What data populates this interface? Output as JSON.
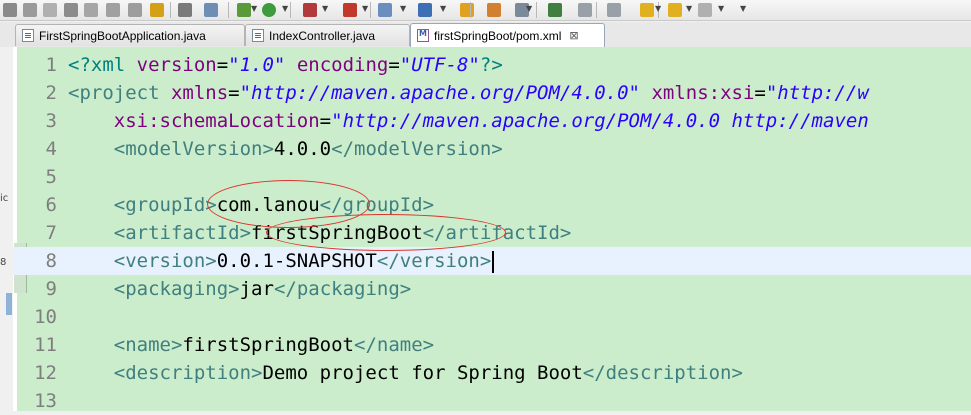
{
  "toolbar": {
    "icons": [
      "save-all-icon",
      "stop-icon",
      "disconnect-icon",
      "step-into-icon",
      "step-over-icon",
      "step-return-icon",
      "drop-to-frame-icon",
      "use-step-filters-icon",
      "open-task-icon",
      "build-icon",
      "debug-icon",
      "run-icon",
      "coverage-icon",
      "run-last-tool-icon",
      "new-wizard-icon",
      "new-class-icon",
      "open-type-icon",
      "search-icon",
      "globe-icon",
      "external-tools-icon",
      "next-annotation-icon",
      "prev-annotation-icon",
      "last-edit-icon",
      "back-icon",
      "forward-icon"
    ]
  },
  "tabs": [
    {
      "label": "FirstSpringBootApplication.java",
      "type": "java",
      "active": false
    },
    {
      "label": "IndexController.java",
      "type": "java",
      "active": false
    },
    {
      "label": "firstSpringBoot/pom.xml",
      "type": "xml",
      "active": true,
      "close": "⊠"
    }
  ],
  "left_fragments": [
    "ic",
    "8"
  ],
  "editor": {
    "current_line": 8,
    "lines": [
      {
        "n": "1",
        "parts": [
          [
            "pi",
            "<?xml "
          ],
          [
            "a",
            "version"
          ],
          [
            "",
            "="
          ],
          [
            "v",
            "\"1.0\""
          ],
          [
            "pi",
            " "
          ],
          [
            "a",
            "encoding"
          ],
          [
            "",
            "="
          ],
          [
            "v",
            "\"UTF-8\""
          ],
          [
            "pi",
            "?>"
          ]
        ]
      },
      {
        "n": "2",
        "parts": [
          [
            "t",
            "<project "
          ],
          [
            "a",
            "xmlns"
          ],
          [
            "",
            "="
          ],
          [
            "v",
            "\"http://maven.apache.org/POM/4.0.0\""
          ],
          [
            "",
            " "
          ],
          [
            "a",
            "xmlns:xsi"
          ],
          [
            "",
            "="
          ],
          [
            "v",
            "\"http://w"
          ]
        ]
      },
      {
        "n": "3",
        "parts": [
          [
            "",
            "    "
          ],
          [
            "a",
            "xsi:schemaLocation"
          ],
          [
            "",
            "="
          ],
          [
            "v",
            "\"http://maven.apache.org/POM/4.0.0 http://maven"
          ]
        ]
      },
      {
        "n": "4",
        "parts": [
          [
            "",
            "    "
          ],
          [
            "t",
            "<modelVersion>"
          ],
          [
            "",
            "4.0.0"
          ],
          [
            "t",
            "</modelVersion>"
          ]
        ]
      },
      {
        "n": "5",
        "parts": [
          [
            "",
            ""
          ]
        ]
      },
      {
        "n": "6",
        "parts": [
          [
            "",
            "    "
          ],
          [
            "t",
            "<groupId>"
          ],
          [
            "",
            "com.lanou"
          ],
          [
            "t",
            "</groupId>"
          ]
        ]
      },
      {
        "n": "7",
        "parts": [
          [
            "",
            "    "
          ],
          [
            "t",
            "<artifactId>"
          ],
          [
            "",
            "firstSpringBoot"
          ],
          [
            "t",
            "</artifactId>"
          ]
        ]
      },
      {
        "n": "8",
        "parts": [
          [
            "",
            "    "
          ],
          [
            "t",
            "<version>"
          ],
          [
            "",
            "0.0.1-SNAPSHOT"
          ],
          [
            "t",
            "</version>"
          ]
        ]
      },
      {
        "n": "9",
        "parts": [
          [
            "",
            "    "
          ],
          [
            "t",
            "<packaging>"
          ],
          [
            "",
            "jar"
          ],
          [
            "t",
            "</packaging>"
          ]
        ]
      },
      {
        "n": "10",
        "parts": [
          [
            "",
            ""
          ]
        ]
      },
      {
        "n": "11",
        "parts": [
          [
            "",
            "    "
          ],
          [
            "t",
            "<name>"
          ],
          [
            "",
            "firstSpringBoot"
          ],
          [
            "t",
            "</name>"
          ]
        ]
      },
      {
        "n": "12",
        "parts": [
          [
            "",
            "    "
          ],
          [
            "t",
            "<description>"
          ],
          [
            "",
            "Demo project for Spring Boot"
          ],
          [
            "t",
            "</description>"
          ]
        ]
      },
      {
        "n": "13",
        "parts": [
          [
            "",
            ""
          ]
        ]
      }
    ]
  },
  "colors": {
    "editor_bg": "#ccedcc",
    "current_line_bg": "#e8f2fe",
    "tag": "#3f7f7f",
    "attribute": "#7f007f",
    "string": "#2a00ff",
    "annotation_ellipse": "#d9362e"
  }
}
